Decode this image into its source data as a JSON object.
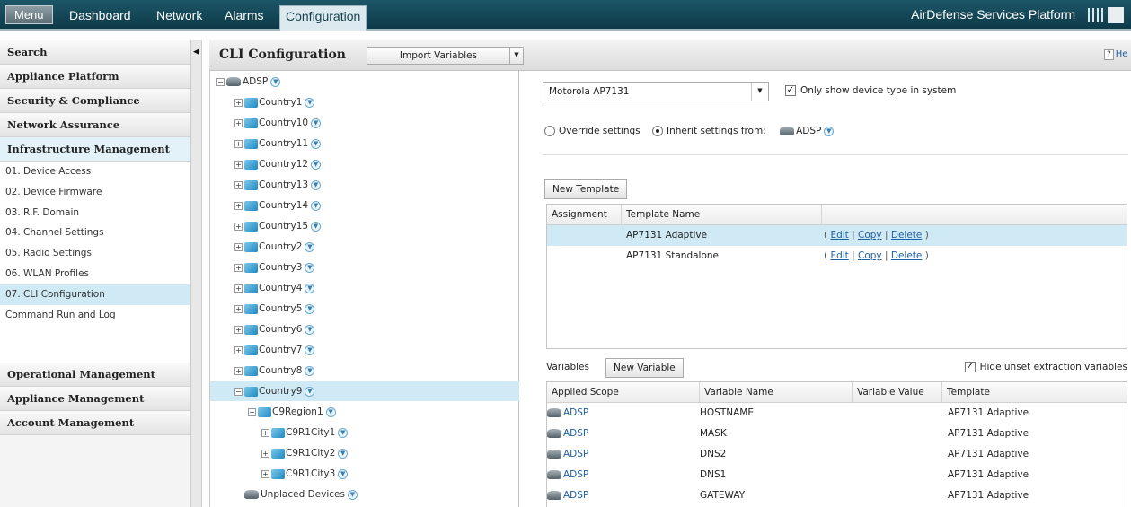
{
  "topbar": {
    "menu_label": "Menu",
    "nav": [
      "Dashboard",
      "Network",
      "Alarms",
      "Configuration"
    ],
    "active_nav": "Configuration",
    "product_name": "AirDefense Services Platform"
  },
  "sidebar": {
    "sections_top": [
      "Search",
      "Appliance Platform",
      "Security & Compliance",
      "Network Assurance",
      "Infrastructure Management"
    ],
    "items": [
      "01. Device Access",
      "02. Device Firmware",
      "03. R.F. Domain",
      "04. Channel Settings",
      "05. Radio Settings",
      "06. WLAN Profiles",
      "07. CLI Configuration",
      "Command Run and Log"
    ],
    "active_item": "07. CLI Configuration",
    "sections_bottom": [
      "Operational Management",
      "Appliance Management",
      "Account Management"
    ]
  },
  "header": {
    "title": "CLI Configuration",
    "import_label": "Import Variables",
    "help_label": "He"
  },
  "tree": {
    "root": "ADSP",
    "countries": [
      "Country1",
      "Country10",
      "Country11",
      "Country12",
      "Country13",
      "Country14",
      "Country15",
      "Country2",
      "Country3",
      "Country4",
      "Country5",
      "Country6",
      "Country7",
      "Country8",
      "Country9"
    ],
    "selected": "Country9",
    "region": "C9Region1",
    "cities": [
      "C9R1City1",
      "C9R1City2",
      "C9R1City3"
    ],
    "unplaced": "Unplaced Devices"
  },
  "content": {
    "device_type": "Motorola AP7131",
    "only_show_label": "Only show device type in system",
    "only_show_checked": true,
    "override_label": "Override settings",
    "inherit_label": "Inherit settings from:",
    "inherit_from": "ADSP",
    "new_template_label": "New Template",
    "template_columns": [
      "Assignment",
      "Template Name"
    ],
    "templates": [
      {
        "name": "AP7131 Adaptive",
        "actions": [
          "Edit",
          "Copy",
          "Delete"
        ]
      },
      {
        "name": "AP7131 Standalone",
        "actions": [
          "Edit",
          "Copy",
          "Delete"
        ]
      }
    ],
    "variables_tab": "Variables",
    "new_variable_label": "New Variable",
    "hide_unset_label": "Hide unset extraction variables",
    "hide_unset_checked": true,
    "variable_columns": [
      "Applied Scope",
      "Variable Name",
      "Variable Value",
      "Template"
    ],
    "variables": [
      {
        "scope": "ADSP",
        "name": "HOSTNAME",
        "value": "",
        "template": "AP7131 Adaptive"
      },
      {
        "scope": "ADSP",
        "name": "MASK",
        "value": "",
        "template": "AP7131 Adaptive"
      },
      {
        "scope": "ADSP",
        "name": "DNS2",
        "value": "",
        "template": "AP7131 Adaptive"
      },
      {
        "scope": "ADSP",
        "name": "DNS1",
        "value": "",
        "template": "AP7131 Adaptive"
      },
      {
        "scope": "ADSP",
        "name": "GATEWAY",
        "value": "",
        "template": "AP7131 Adaptive"
      }
    ]
  },
  "colors": {
    "topbar": "#0e3a48",
    "selection": "#cfeaf5",
    "link": "#1f5fa8"
  }
}
